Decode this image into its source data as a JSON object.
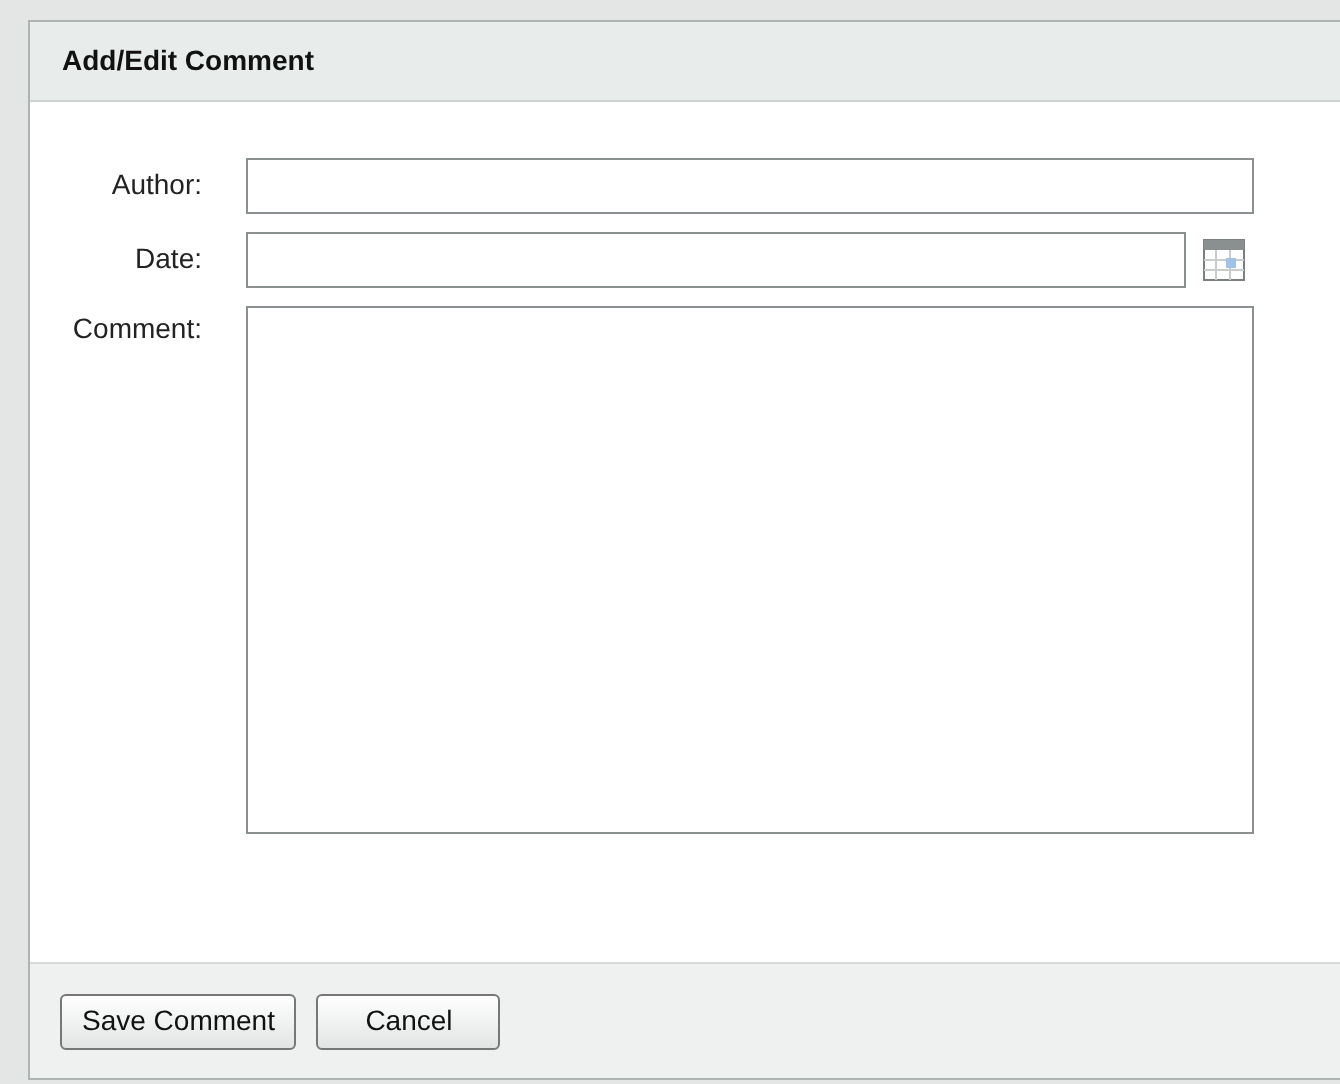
{
  "dialog": {
    "title": "Add/Edit Comment"
  },
  "fields": [
    {
      "kind": "text",
      "label": "Author:"
    },
    {
      "kind": "date",
      "label": "Date:"
    },
    {
      "kind": "textarea",
      "label": "Comment:"
    }
  ],
  "buttons": [
    "Save Comment",
    "Cancel"
  ]
}
